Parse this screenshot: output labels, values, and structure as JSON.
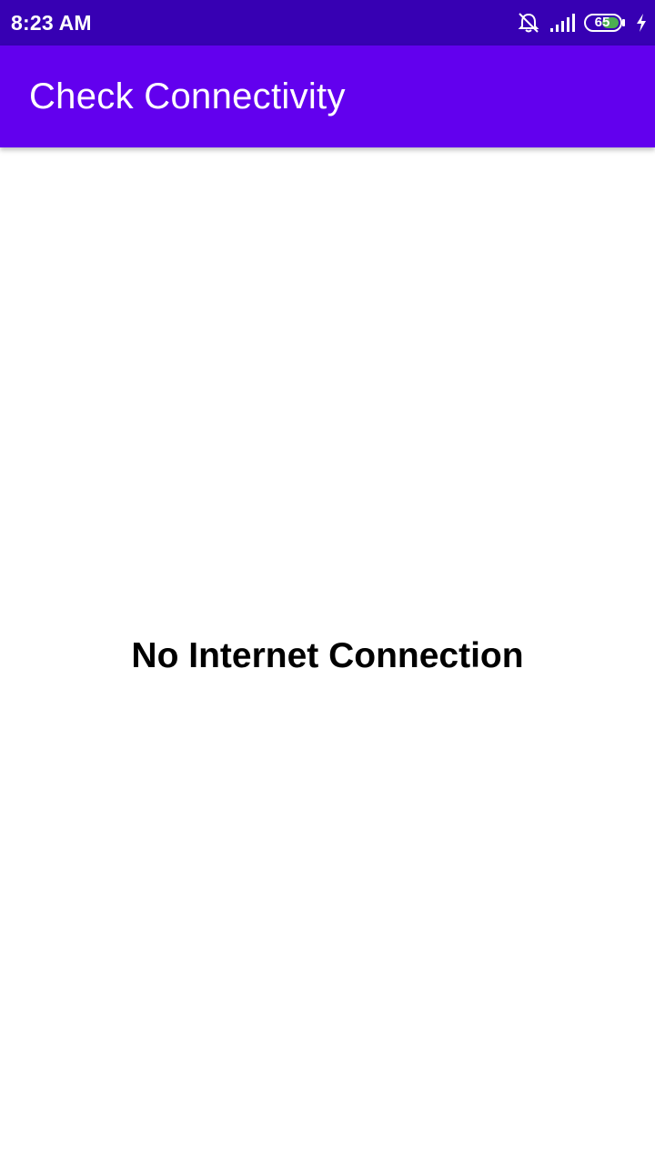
{
  "status_bar": {
    "time": "8:23 AM",
    "battery_level": "65",
    "icons": [
      "silent-alarm-icon",
      "signal-icon",
      "battery-icon",
      "charging-icon"
    ],
    "background": "#3700b3"
  },
  "app_bar": {
    "title": "Check Connectivity",
    "background": "#6200ee"
  },
  "main": {
    "message": "No Internet Connection"
  }
}
